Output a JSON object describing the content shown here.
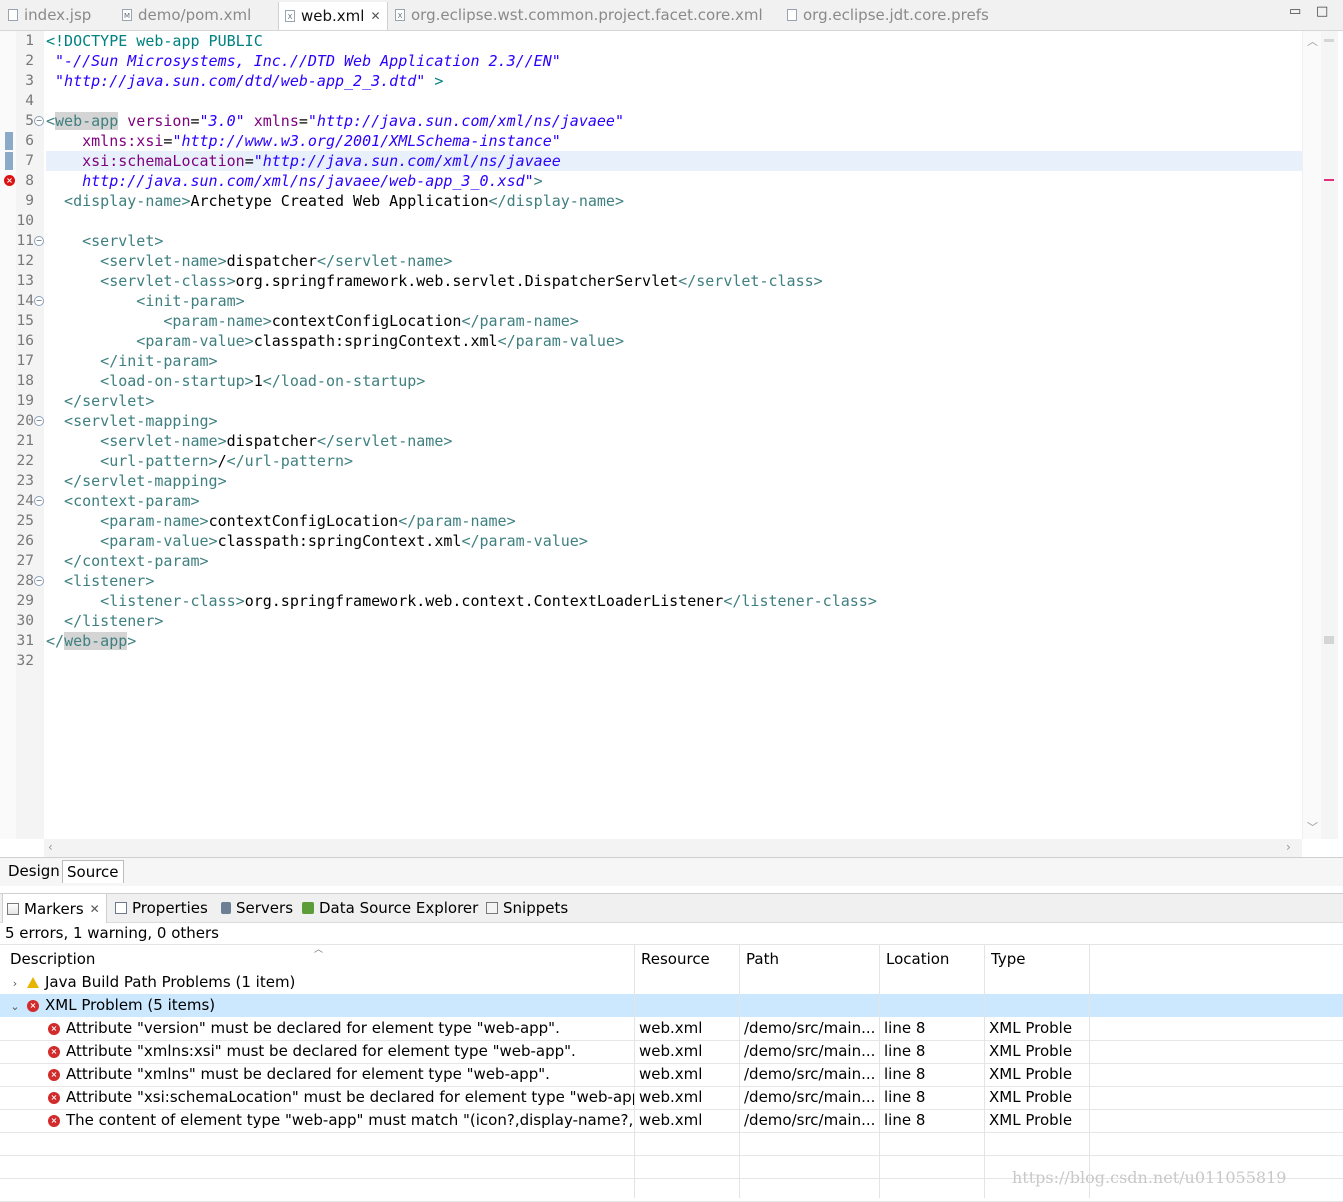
{
  "editor_tabs": [
    {
      "label": "index.jsp",
      "active": false
    },
    {
      "label": "demo/pom.xml",
      "active": false
    },
    {
      "label": "web.xml",
      "active": true
    },
    {
      "label": "org.eclipse.wst.common.project.facet.core.xml",
      "active": false
    },
    {
      "label": "org.eclipse.jdt.core.prefs",
      "active": false
    }
  ],
  "window_controls": {
    "minimize": "▭",
    "maximize": "□"
  },
  "code": {
    "line_numbers": [
      "1",
      "2",
      "3",
      "4",
      "5",
      "6",
      "7",
      "8",
      "9",
      "10",
      "11",
      "12",
      "13",
      "14",
      "15",
      "16",
      "17",
      "18",
      "19",
      "20",
      "21",
      "22",
      "23",
      "24",
      "25",
      "26",
      "27",
      "28",
      "29",
      "30",
      "31",
      "32"
    ],
    "fold_lines": [
      5,
      11,
      14,
      20,
      24,
      28
    ],
    "error_line": 8,
    "highlighted_line": 7,
    "lines": [
      [
        [
          "dtd",
          "<!DOCTYPE web-app PUBLIC"
        ]
      ],
      [
        [
          "val",
          " \"-//Sun Microsystems, Inc.//DTD Web Application 2.3//EN\""
        ]
      ],
      [
        [
          "val",
          " \"http://java.sun.com/dtd/web-app_2_3.dtd\""
        ],
        [
          "dtd",
          " >"
        ]
      ],
      [],
      [
        [
          "tag",
          "<"
        ],
        [
          "tag hi",
          "web-app"
        ],
        [
          "attr",
          " version"
        ],
        [
          "txt",
          "="
        ],
        [
          "val",
          "\"3.0\""
        ],
        [
          "attr",
          " xmlns"
        ],
        [
          "txt",
          "="
        ],
        [
          "val",
          "\"http://java.sun.com/xml/ns/javaee\""
        ]
      ],
      [
        [
          "attr",
          "    xmlns:xsi"
        ],
        [
          "txt",
          "="
        ],
        [
          "val",
          "\"http://www.w3.org/2001/XMLSchema-instance\""
        ]
      ],
      [
        [
          "attr",
          "    xsi:schemaLocation"
        ],
        [
          "txt",
          "="
        ],
        [
          "val",
          "\"http://java.sun.com/xml/ns/javaee"
        ]
      ],
      [
        [
          "val",
          "    http://java.sun.com/xml/ns/javaee/web-app_3_0.xsd\""
        ],
        [
          "tag",
          ">"
        ]
      ],
      [
        [
          "tag",
          "  <display-name>"
        ],
        [
          "txt",
          "Archetype Created Web Application"
        ],
        [
          "tag",
          "</display-name>"
        ]
      ],
      [],
      [
        [
          "tag",
          "    <servlet>"
        ]
      ],
      [
        [
          "tag",
          "      <servlet-name>"
        ],
        [
          "txt",
          "dispatcher"
        ],
        [
          "tag",
          "</servlet-name>"
        ]
      ],
      [
        [
          "tag",
          "      <servlet-class>"
        ],
        [
          "txt",
          "org.springframework.web.servlet.DispatcherServlet"
        ],
        [
          "tag",
          "</servlet-class>"
        ]
      ],
      [
        [
          "tag",
          "          <init-param>"
        ]
      ],
      [
        [
          "tag",
          "             <param-name>"
        ],
        [
          "txt",
          "contextConfigLocation"
        ],
        [
          "tag",
          "</param-name>"
        ]
      ],
      [
        [
          "tag",
          "          <param-value>"
        ],
        [
          "txt",
          "classpath:springContext.xml"
        ],
        [
          "tag",
          "</param-value>"
        ]
      ],
      [
        [
          "tag",
          "      </init-param>"
        ]
      ],
      [
        [
          "tag",
          "      <load-on-startup>"
        ],
        [
          "txt",
          "1"
        ],
        [
          "tag",
          "</load-on-startup>"
        ]
      ],
      [
        [
          "tag",
          "  </servlet>"
        ]
      ],
      [
        [
          "tag",
          "  <servlet-mapping>"
        ]
      ],
      [
        [
          "tag",
          "      <servlet-name>"
        ],
        [
          "txt",
          "dispatcher"
        ],
        [
          "tag",
          "</servlet-name>"
        ]
      ],
      [
        [
          "tag",
          "      <url-pattern>"
        ],
        [
          "txt",
          "/"
        ],
        [
          "tag",
          "</url-pattern>"
        ]
      ],
      [
        [
          "tag",
          "  </servlet-mapping>"
        ]
      ],
      [
        [
          "tag",
          "  <context-param>"
        ]
      ],
      [
        [
          "tag",
          "      <param-name>"
        ],
        [
          "txt",
          "contextConfigLocation"
        ],
        [
          "tag",
          "</param-name>"
        ]
      ],
      [
        [
          "tag",
          "      <param-value>"
        ],
        [
          "txt",
          "classpath:springContext.xml"
        ],
        [
          "tag",
          "</param-value>"
        ]
      ],
      [
        [
          "tag",
          "  </context-param>"
        ]
      ],
      [
        [
          "tag",
          "  <listener>"
        ]
      ],
      [
        [
          "tag",
          "      <listener-class>"
        ],
        [
          "txt",
          "org.springframework.web.context.ContextLoaderListener"
        ],
        [
          "tag",
          "</listener-class>"
        ]
      ],
      [
        [
          "tag",
          "  </listener>"
        ]
      ],
      [
        [
          "tag",
          "</"
        ],
        [
          "tag hi",
          "web-app"
        ],
        [
          "tag",
          ">"
        ]
      ],
      []
    ]
  },
  "bottom_tabs": {
    "design": "Design",
    "source": "Source"
  },
  "view_tabs": [
    {
      "label": "Markers",
      "icon": "markers-icon",
      "active": true
    },
    {
      "label": "Properties",
      "icon": "properties-icon",
      "active": false
    },
    {
      "label": "Servers",
      "icon": "servers-icon",
      "active": false
    },
    {
      "label": "Data Source Explorer",
      "icon": "data-source-icon",
      "active": false
    },
    {
      "label": "Snippets",
      "icon": "snippets-icon",
      "active": false
    }
  ],
  "markers": {
    "summary": "5 errors, 1 warning, 0 others",
    "columns": [
      "Description",
      "Resource",
      "Path",
      "Location",
      "Type"
    ],
    "groups": [
      {
        "label": "Java Build Path Problems (1 item)",
        "severity": "warning",
        "expanded": false
      },
      {
        "label": "XML Problem (5 items)",
        "severity": "error",
        "expanded": true
      }
    ],
    "rows": [
      {
        "description": "Attribute \"version\" must be declared for element type \"web-app\".",
        "resource": "web.xml",
        "path": "/demo/src/main...",
        "location": "line 8",
        "type": "XML Proble"
      },
      {
        "description": "Attribute \"xmlns:xsi\" must be declared for element type \"web-app\".",
        "resource": "web.xml",
        "path": "/demo/src/main...",
        "location": "line 8",
        "type": "XML Proble"
      },
      {
        "description": "Attribute \"xmlns\" must be declared for element type \"web-app\".",
        "resource": "web.xml",
        "path": "/demo/src/main...",
        "location": "line 8",
        "type": "XML Proble"
      },
      {
        "description": "Attribute \"xsi:schemaLocation\" must be declared for element type \"web-app\"",
        "resource": "web.xml",
        "path": "/demo/src/main...",
        "location": "line 8",
        "type": "XML Proble"
      },
      {
        "description": "The content of element type \"web-app\" must match \"(icon?,display-name?,des",
        "resource": "web.xml",
        "path": "/demo/src/main...",
        "location": "line 8",
        "type": "XML Proble"
      }
    ]
  },
  "watermark": "https://blog.csdn.net/u011055819",
  "colors": {
    "tag": "#3f7f7f",
    "attribute": "#7f007f",
    "value": "#2a00ff",
    "doctype": "#008080",
    "selection": "#cce8ff",
    "error": "#d12b2b",
    "warning": "#e8b400"
  }
}
